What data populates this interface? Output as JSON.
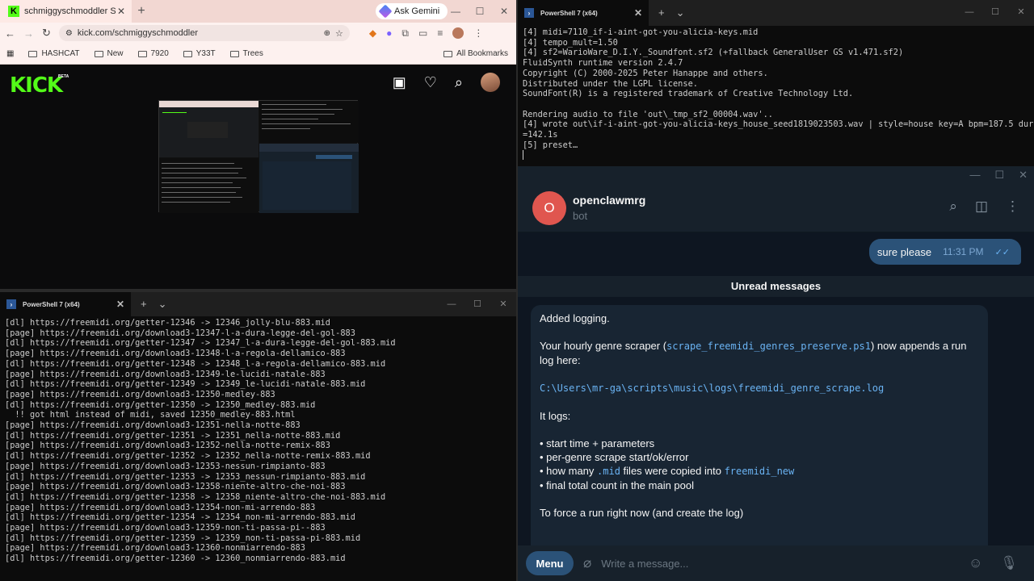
{
  "chrome": {
    "tab_title": "schmiggyschmoddler Stream -",
    "tab_close": "✕",
    "new_tab": "+",
    "gemini": "Ask Gemini",
    "url": "kick.com/schmiggyschmoddler",
    "bookmarks": [
      "HASHCAT",
      "New",
      "7920",
      "Y33T",
      "Trees"
    ],
    "all_bookmarks": "All Bookmarks",
    "kick_logo": "KICK",
    "kick_beta": "BETA"
  },
  "ps_top": {
    "tab_title": "PowerShell 7 (x64)",
    "lines": [
      "[4] midi=7110_if-i-aint-got-you-alicia-keys.mid",
      "[4] tempo_mult=1.50",
      "[4] sf2=WarioWare_D.I.Y._Soundfont.sf2 (+fallback GeneralUser GS v1.471.sf2)",
      "FluidSynth runtime version 2.4.7",
      "Copyright (C) 2000-2025 Peter Hanappe and others.",
      "Distributed under the LGPL license.",
      "SoundFont(R) is a registered trademark of Creative Technology Ltd.",
      "",
      "Rendering audio to file 'out\\_tmp_sf2_00004.wav'..",
      "[4] wrote out\\if-i-aint-got-you-alicia-keys_house_seed1819023503.wav | style=house key=A bpm=187.5 dur",
      "=142.1s",
      "[5] preset…"
    ]
  },
  "ps_bottom": {
    "tab_title": "PowerShell 7 (x64)",
    "lines": [
      "[dl] https://freemidi.org/getter-12346 -> 12346_jolly-blu-883.mid",
      "[page] https://freemidi.org/download3-12347-l-a-dura-legge-del-gol-883",
      "[dl] https://freemidi.org/getter-12347 -> 12347_l-a-dura-legge-del-gol-883.mid",
      "[page] https://freemidi.org/download3-12348-l-a-regola-dellamico-883",
      "[dl] https://freemidi.org/getter-12348 -> 12348_l-a-regola-dellamico-883.mid",
      "[page] https://freemidi.org/download3-12349-le-lucidi-natale-883",
      "[dl] https://freemidi.org/getter-12349 -> 12349_le-lucidi-natale-883.mid",
      "[page] https://freemidi.org/download3-12350-medley-883",
      "[dl] https://freemidi.org/getter-12350 -> 12350_medley-883.mid",
      "  !! got html instead of midi, saved 12350_medley-883.html",
      "[page] https://freemidi.org/download3-12351-nella-notte-883",
      "[dl] https://freemidi.org/getter-12351 -> 12351_nella-notte-883.mid",
      "[page] https://freemidi.org/download3-12352-nella-notte-remix-883",
      "[dl] https://freemidi.org/getter-12352 -> 12352_nella-notte-remix-883.mid",
      "[page] https://freemidi.org/download3-12353-nessun-rimpianto-883",
      "[dl] https://freemidi.org/getter-12353 -> 12353_nessun-rimpianto-883.mid",
      "[page] https://freemidi.org/download3-12358-niente-altro-che-noi-883",
      "[dl] https://freemidi.org/getter-12358 -> 12358_niente-altro-che-noi-883.mid",
      "[page] https://freemidi.org/download3-12354-non-mi-arrendo-883",
      "[dl] https://freemidi.org/getter-12354 -> 12354_non-mi-arrendo-883.mid",
      "[page] https://freemidi.org/download3-12359-non-ti-passa-pi--883",
      "[dl] https://freemidi.org/getter-12359 -> 12359_non-ti-passa-pi-883.mid",
      "[page] https://freemidi.org/download3-12360-nonmiarrendo-883",
      "[dl] https://freemidi.org/getter-12360 -> 12360_nonmiarrendo-883.mid"
    ]
  },
  "telegram": {
    "avatar_letter": "O",
    "name": "openclawmrg",
    "status": "bot",
    "out_message": "sure please",
    "out_time": "11:31 PM",
    "unread_label": "Unread messages",
    "msg": {
      "p1": "Added logging.",
      "p2_a": "Your hourly genre scraper (",
      "p2_code": "scrape_freemidi_genres_preserve.ps1",
      "p2_b": ") now appends a run log here:",
      "path": "C:\\Users\\mr-ga\\scripts\\music\\logs\\freemidi_genre_scrape.log",
      "p3": "It logs:",
      "b1": "• start time + parameters",
      "b2": "• per-genre scrape start/ok/error",
      "b3_a": "• how many ",
      "b3_code1": ".mid",
      "b3_b": " files were copied into ",
      "b3_code2": "freemidi_new",
      "b4": "• final total count in the main pool",
      "p4": "To force a run right now (and create the log)"
    },
    "menu_label": "Menu",
    "input_placeholder": "Write a message..."
  }
}
